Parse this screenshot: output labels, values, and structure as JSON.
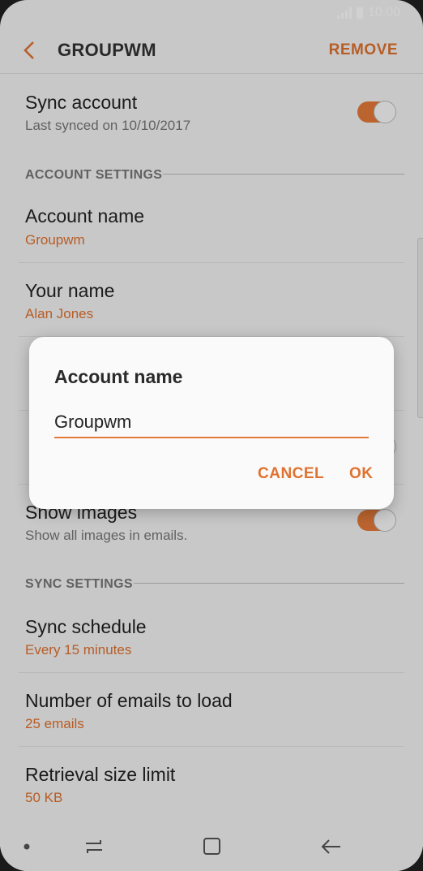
{
  "status": {
    "time": "10:00"
  },
  "appbar": {
    "title": "GROUPWM",
    "remove_label": "REMOVE"
  },
  "sync_account": {
    "title": "Sync account",
    "subtitle": "Last synced on 10/10/2017",
    "enabled": true
  },
  "account_settings": {
    "header": "ACCOUNT SETTINGS",
    "account_name": {
      "title": "Account name",
      "value": "Groupwm"
    },
    "your_name": {
      "title": "Your name",
      "value": "Alan Jones"
    },
    "show_images": {
      "title": "Show images",
      "subtitle": "Show all images in emails.",
      "enabled": true
    }
  },
  "sync_settings": {
    "header": "SYNC SETTINGS",
    "sync_schedule": {
      "title": "Sync schedule",
      "value": "Every 15 minutes"
    },
    "emails_to_load": {
      "title": "Number of emails to load",
      "value": "25 emails"
    },
    "retrieval_limit": {
      "title": "Retrieval size limit",
      "value": "50 KB"
    }
  },
  "dialog": {
    "title": "Account name",
    "input_value": "Groupwm",
    "cancel_label": "CANCEL",
    "ok_label": "OK"
  },
  "colors": {
    "accent": "#e0722f",
    "toggle_on": "#e47b3a"
  }
}
